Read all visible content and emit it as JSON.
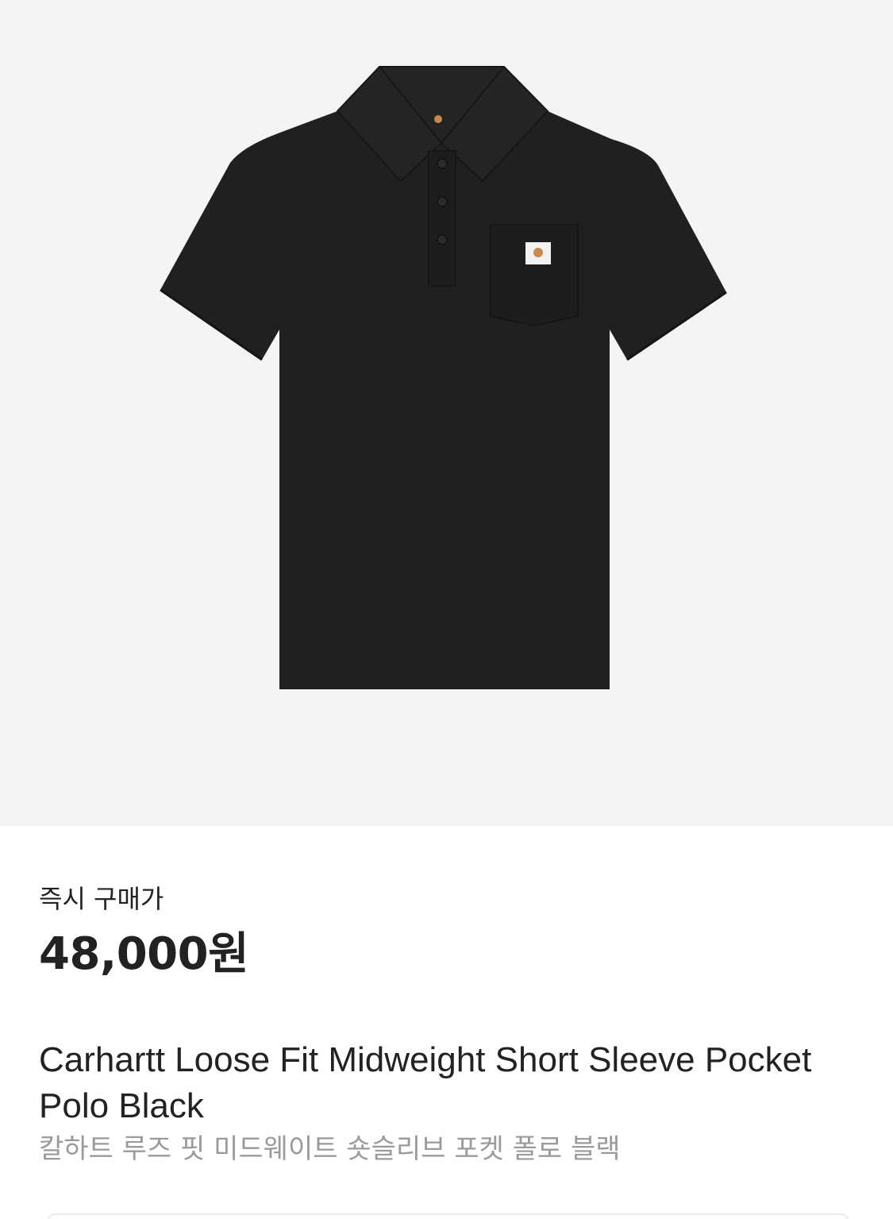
{
  "product": {
    "image_subject": "polo-shirt",
    "image_color": "#1f2022",
    "background_color": "#f4f4f4",
    "price_label": "즉시 구매가",
    "price": "48,000원",
    "title_en": "Carhartt Loose Fit Midweight Short Sleeve Pocket Polo Black",
    "title_ko": "칼하트 루즈 핏 미드웨이트 숏슬리브 포켓 폴로 블랙"
  },
  "colors": {
    "text_primary": "#222222",
    "text_secondary": "#9a9a9a"
  }
}
